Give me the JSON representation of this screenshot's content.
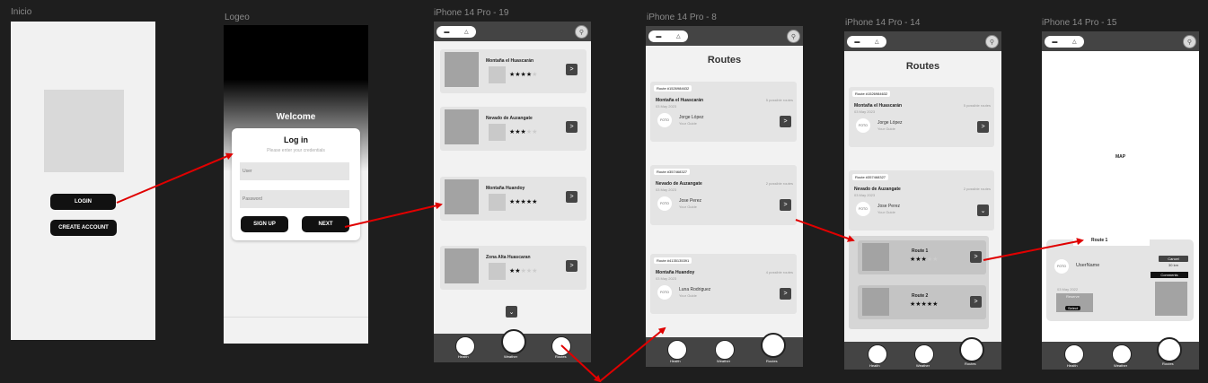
{
  "frames": {
    "inicio": {
      "label": "Inicio",
      "login_label": "LOGIN",
      "create_label": "CREATE ACCOUNT"
    },
    "logeo": {
      "label": "Logeo",
      "welcome": "Welcome",
      "title": "Log in",
      "subtitle": "Please enter your credentials",
      "user_placeholder": "User",
      "password_placeholder": "Password",
      "signup_label": "SIGN UP",
      "next_label": "NEXT"
    },
    "p19": {
      "label": "iPhone 14 Pro - 19",
      "items": [
        {
          "name": "Montaña el Huascarán",
          "stars": 4
        },
        {
          "name": "Nevado de Auzangate",
          "stars": 3
        },
        {
          "name": "Montaña Huandoy",
          "stars": 5
        },
        {
          "name": "Zona Alta Huascaran",
          "stars": 2
        }
      ],
      "expand_icon": "chevron-down-icon"
    },
    "p8": {
      "label": "iPhone 14 Pro - 8",
      "title": "Routes",
      "routes": [
        {
          "id": "Route #1526984632",
          "name": "Montaña el Huascarán",
          "date": "03 May 2023",
          "count": "5 possible routes",
          "guide": "Jorge López",
          "role": "Your Guide",
          "foto": "FOTO"
        },
        {
          "id": "Route #357468327",
          "name": "Nevado de Auzangate",
          "date": "03 May 2023",
          "count": "2 possible routes",
          "guide": "Jose Perez",
          "role": "Your Guide",
          "foto": "FOTO"
        },
        {
          "id": "Route #4135135391",
          "name": "Montaña Huandoy",
          "date": "03 May 2023",
          "count": "4 possible routes",
          "guide": "Luna Rodriguez",
          "role": "Your Guide",
          "foto": "FOTO"
        }
      ]
    },
    "p14": {
      "label": "iPhone 14 Pro - 14",
      "title": "Routes",
      "routes": [
        {
          "id": "Route #1526984632",
          "name": "Montaña el Huascarán",
          "date": "03 May 2023",
          "count": "5 possible routes",
          "guide": "Jorge López",
          "role": "Your Guide",
          "foto": "FOTO"
        },
        {
          "id": "Route #357468327",
          "name": "Nevado de Auzangate",
          "date": "03 May 2023",
          "count": "2 possible routes",
          "guide": "Jose Perez",
          "role": "Your Guide",
          "foto": "FOTO"
        }
      ],
      "subroutes": [
        {
          "name": "Route 1",
          "stars": 3
        },
        {
          "name": "Route 2",
          "stars": 5
        }
      ]
    },
    "p15": {
      "label": "iPhone 14 Pro - 15",
      "map_label": "MAP",
      "route_tab": "Route 1",
      "foto": "FOTO",
      "username": "UserName",
      "date": "03 May 2022",
      "reserve": "Reserve",
      "select": "Select",
      "cancel": "Cancel",
      "distance": "30 km",
      "comments": "Comments"
    }
  },
  "nav": {
    "health": "Health",
    "weather": "Weather",
    "routes": "Routes"
  },
  "colors": {
    "canvas": "#1e1e1e",
    "accent_arrow": "#e00000",
    "dark_button": "#111111",
    "nav_bar": "#444444"
  }
}
